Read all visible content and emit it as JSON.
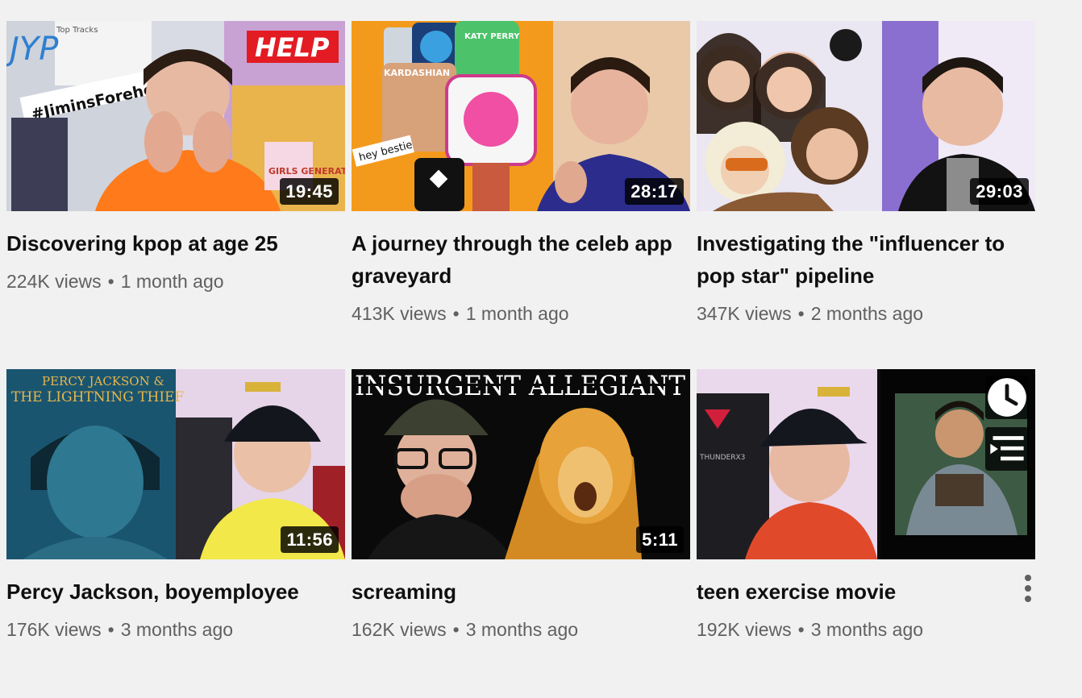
{
  "videos": [
    {
      "title": "Discovering kpop at age 25",
      "views": "224K views",
      "age": "1 month ago",
      "duration": "19:45",
      "thumb_text": [
        "JYP",
        "Top Tracks",
        "HELP",
        "#JiminsForehead",
        "GIRLS GENERATION"
      ]
    },
    {
      "title": "A journey through the celeb app graveyard",
      "views": "413K views",
      "age": "1 month ago",
      "duration": "28:17",
      "thumb_text": [
        "KATY PERRY",
        "KARDASHIAN",
        "hey bestie"
      ]
    },
    {
      "title": "Investigating the \"influencer to pop star\" pipeline",
      "views": "347K views",
      "age": "2 months ago",
      "duration": "29:03",
      "thumb_text": []
    },
    {
      "title": "Percy Jackson, boyemployee",
      "views": "176K views",
      "age": "3 months ago",
      "duration": "11:56",
      "thumb_text": [
        "PERCY JACKSON &",
        "THE LIGHTNING THIEF"
      ]
    },
    {
      "title": "screaming",
      "views": "162K views",
      "age": "3 months ago",
      "duration": "5:11",
      "thumb_text": [
        "INSURGENT ALLEGIANT"
      ]
    },
    {
      "title": "teen exercise movie",
      "views": "192K views",
      "age": "3 months ago",
      "duration": "",
      "thumb_text": [
        "THUNDERX3"
      ]
    }
  ],
  "separator": "•",
  "icons": {
    "watch_later": "clock-icon",
    "add_to_queue": "queue-icon",
    "menu": "more-vert-icon"
  },
  "colors": {
    "background": "#f1f1f1",
    "meta": "#606060",
    "title": "#0f0f0f"
  }
}
